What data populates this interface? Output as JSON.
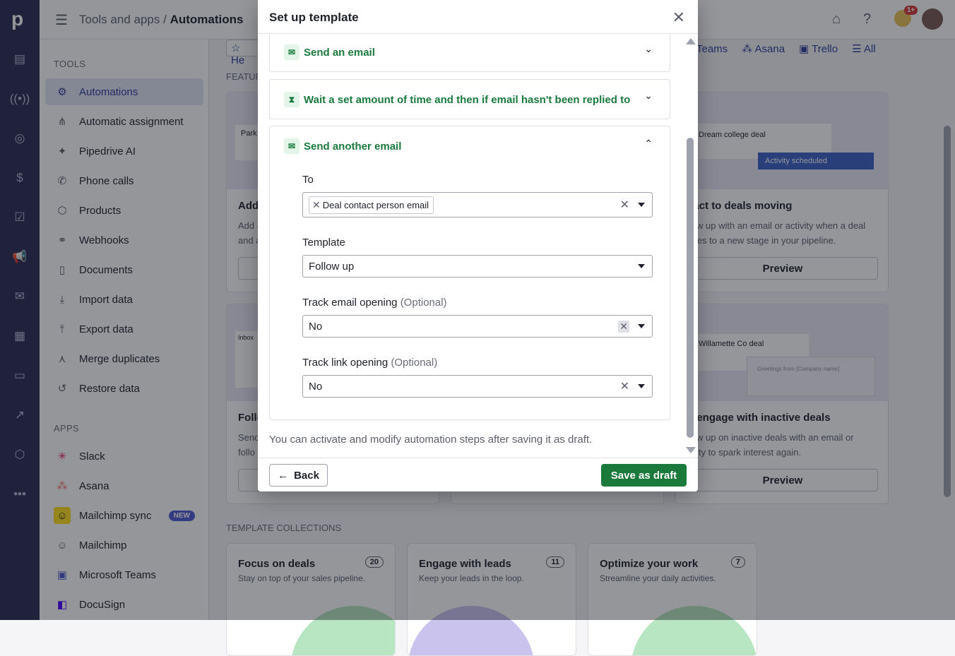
{
  "topbar": {
    "crumb_parent": "Tools and apps",
    "crumb_sep": "/",
    "crumb_current": "Automations",
    "notif_count": "1+"
  },
  "sidebar": {
    "tools_title": "TOOLS",
    "tools": [
      {
        "label": "Automations",
        "icon": "robot-icon",
        "active": true
      },
      {
        "label": "Automatic assignment",
        "icon": "hierarchy-icon"
      },
      {
        "label": "Pipedrive AI",
        "icon": "sparkle-icon"
      },
      {
        "label": "Phone calls",
        "icon": "phone-icon"
      },
      {
        "label": "Products",
        "icon": "box-icon"
      },
      {
        "label": "Webhooks",
        "icon": "webhook-icon"
      },
      {
        "label": "Documents",
        "icon": "document-icon"
      },
      {
        "label": "Import data",
        "icon": "download-icon"
      },
      {
        "label": "Export data",
        "icon": "upload-icon"
      },
      {
        "label": "Merge duplicates",
        "icon": "merge-icon"
      },
      {
        "label": "Restore data",
        "icon": "restore-icon"
      }
    ],
    "apps_title": "APPS",
    "apps": [
      {
        "label": "Slack",
        "icon": "slack-icon"
      },
      {
        "label": "Asana",
        "icon": "asana-icon"
      },
      {
        "label": "Mailchimp sync",
        "icon": "mailchimp-icon",
        "badge": "NEW"
      },
      {
        "label": "Mailchimp",
        "icon": "mailchimp-icon"
      },
      {
        "label": "Microsoft Teams",
        "icon": "teams-icon"
      },
      {
        "label": "DocuSign",
        "icon": "docusign-icon"
      }
    ]
  },
  "main": {
    "tabs": [
      "Teams",
      "Asana",
      "Trello",
      "All"
    ],
    "featured_label": "FEATUR",
    "cards": [
      {
        "title": "Add",
        "desc1": "Add a",
        "desc2": "and a",
        "thumb_text": "Park I"
      },
      {
        "title": "eact to deals moving",
        "desc1": "llow up with an email or activity when a deal",
        "desc2": "oves to a new stage in your pipeline.",
        "preview": "Preview",
        "thumb_text": "Dream college deal",
        "thumb_badge": "Activity scheduled",
        "thumb_money": "$$"
      },
      {
        "title": "Follo",
        "desc1": "Send",
        "desc2": "follo",
        "thumb_text": "Inbox"
      },
      {
        "title": "e-engage with inactive deals",
        "desc1": "llow up on inactive deals with an email or",
        "desc2": "tivity to spark interest again.",
        "preview": "Preview",
        "thumb_text": "Willamette Co deal",
        "thumb_money": "$$",
        "thumb_greeting": "Greetings from [Company name]"
      }
    ],
    "collections_title": "TEMPLATE COLLECTIONS",
    "collections": [
      {
        "title": "Focus on deals",
        "desc": "Stay on top of your sales pipeline.",
        "count": "20"
      },
      {
        "title": "Engage with leads",
        "desc": "Keep your leads in the loop.",
        "count": "11"
      },
      {
        "title": "Optimize your work",
        "desc": "Streamline your daily activities.",
        "count": "7"
      }
    ]
  },
  "modal": {
    "title": "Set up template",
    "steps": [
      {
        "label": "Send an email",
        "icon": "envelope-icon"
      },
      {
        "label": "Wait a set amount of time and then if email hasn't been replied to",
        "icon": "hourglass-icon"
      },
      {
        "label": "Send another email",
        "icon": "envelope-icon"
      }
    ],
    "fields": {
      "to_label": "To",
      "to_chip": "Deal contact person email",
      "template_label": "Template",
      "template_value": "Follow up",
      "track_email_label": "Track email opening",
      "track_email_opt": "(Optional)",
      "track_email_value": "No",
      "track_link_label": "Track link opening",
      "track_link_opt": "(Optional)",
      "track_link_value": "No"
    },
    "note": "You can activate and modify automation steps after saving it as draft.",
    "back_label": "Back",
    "save_label": "Save as draft"
  },
  "colors": {
    "rail": "#2b2a50",
    "accent_green": "#1a7a3c",
    "active_bg": "#e1e3f4",
    "link_blue": "#2f3f9d"
  }
}
